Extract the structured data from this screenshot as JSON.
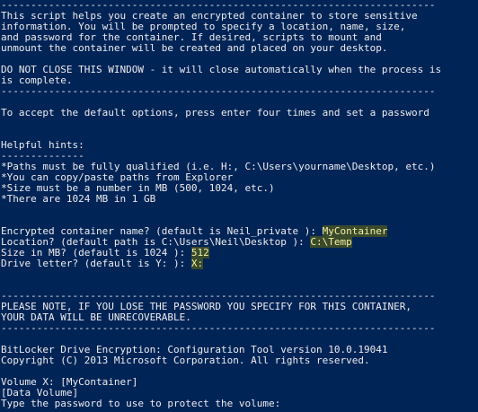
{
  "console": {
    "lines": [
      {
        "text": "-------------------------------------------------------------------------"
      },
      {
        "text": "This script helps you create an encrypted container to store sensitive"
      },
      {
        "text": "information. You will be prompted to specify a location, name, size,"
      },
      {
        "text": "and password for the container. If desired, scripts to mount and"
      },
      {
        "text": "unmount the container will be created and placed on your desktop."
      },
      {
        "text": ""
      },
      {
        "text": "DO NOT CLOSE THIS WINDOW - it will close automatically when the process is"
      },
      {
        "text": "is complete."
      },
      {
        "text": "-------------------------------------------------------------------------"
      },
      {
        "text": ""
      },
      {
        "text": "To accept the default options, press enter four times and set a password"
      },
      {
        "text": ""
      },
      {
        "text": ""
      },
      {
        "text": "Helpful hints:"
      },
      {
        "text": "--------------"
      },
      {
        "text": "*Paths must be fully qualified (i.e. H:, C:\\Users\\yourname\\Desktop, etc.)"
      },
      {
        "text": "*You can copy/paste paths from Explorer"
      },
      {
        "text": "*Size must be a number in MB (500, 1024, etc.)"
      },
      {
        "text": "*There are 1024 MB in 1 GB"
      },
      {
        "text": ""
      },
      {
        "text": ""
      },
      {
        "text": "Encrypted container name? (default is Neil_private ): ",
        "input": "MyContainer"
      },
      {
        "text": "Location? (default path is C:\\Users\\Neil\\Desktop ): ",
        "input": "C:\\Temp"
      },
      {
        "text": "Size in MB? (default is 1024 ): ",
        "input": "512"
      },
      {
        "text": "Drive letter? (default is Y: ): ",
        "input": "X:"
      },
      {
        "text": ""
      },
      {
        "text": ""
      },
      {
        "text": "-------------------------------------------------------------------------"
      },
      {
        "text": "PLEASE NOTE, IF YOU LOSE THE PASSWORD YOU SPECIFY FOR THIS CONTAINER,"
      },
      {
        "text": "YOUR DATA WILL BE UNRECOVERABLE."
      },
      {
        "text": "-------------------------------------------------------------------------"
      },
      {
        "text": ""
      },
      {
        "text": "BitLocker Drive Encryption: Configuration Tool version 10.0.19041"
      },
      {
        "text": "Copyright (C) 2013 Microsoft Corporation. All rights reserved."
      },
      {
        "text": ""
      },
      {
        "text": "Volume X: [MyContainer]"
      },
      {
        "text": "[Data Volume]"
      },
      {
        "text": "Type the password to use to protect the volume:"
      }
    ]
  },
  "colors": {
    "background": "#012456",
    "text": "#eeedf0",
    "input_text": "#f3f0a6"
  }
}
